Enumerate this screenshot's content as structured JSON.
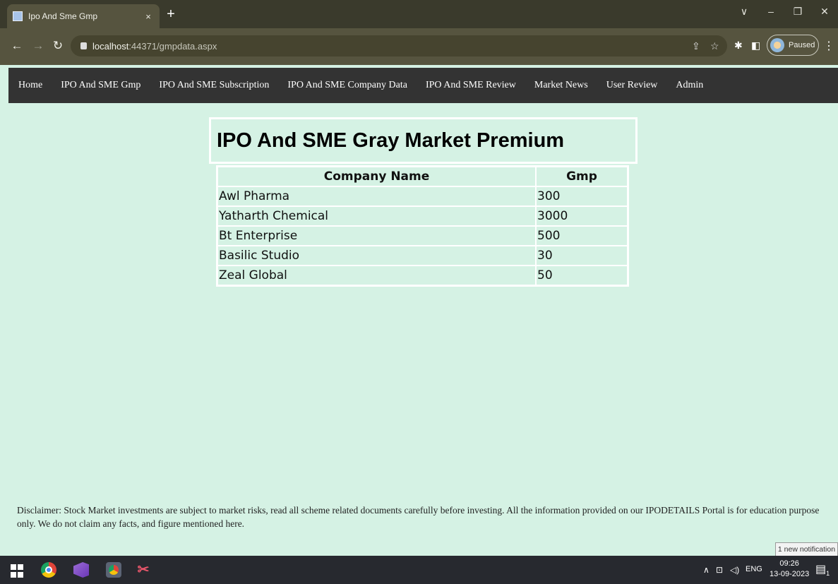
{
  "browser": {
    "tab_title": "Ipo And Sme Gmp",
    "tab_close": "×",
    "new_tab": "+",
    "window_controls": [
      "∨",
      "–",
      "❐",
      "✕"
    ],
    "url_host": "localhost",
    "url_rest": ":44371/gmpdata.aspx",
    "profile_status": "Paused"
  },
  "site_nav": {
    "items": [
      "Home",
      "IPO And SME Gmp",
      "IPO And SME Subscription",
      "IPO And SME Company Data",
      "IPO And SME Review",
      "Market News",
      "User Review",
      "Admin"
    ]
  },
  "page": {
    "title": "IPO And SME Gray Market Premium"
  },
  "table": {
    "headers": [
      "Company Name",
      "Gmp"
    ],
    "rows": [
      [
        "Awl Pharma",
        "300"
      ],
      [
        "Yatharth Chemical",
        "3000"
      ],
      [
        "Bt Enterprise",
        "500"
      ],
      [
        "Basilic Studio",
        "30"
      ],
      [
        "Zeal Global",
        "50"
      ]
    ]
  },
  "disclaimer": "Disclaimer: Stock Market investments are subject to market risks, read all scheme related documents carefully before investing. All the information provided on our IPODETAILS Portal is for education purpose only. We do not claim any facts, and figure mentioned here.",
  "notification_toast": "1 new notification",
  "taskbar": {
    "language": "ENG",
    "time": "09:26",
    "date": "13-09-2023",
    "notification_count": "1"
  },
  "colors": {
    "page_background": "#d5f2e4",
    "nav_background": "#333333",
    "browser_frame": "#3a3a2c",
    "taskbar": "#27292f"
  }
}
